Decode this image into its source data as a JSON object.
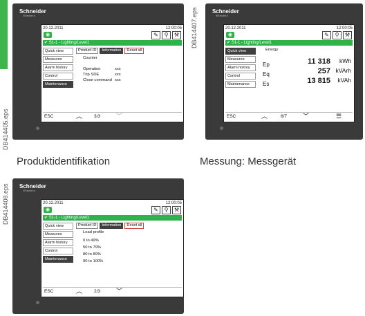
{
  "side_codes": [
    "DB414405.eps",
    "DB414407.eps",
    "DB414408.eps"
  ],
  "brand": {
    "name": "Schneider",
    "sub": "Electric"
  },
  "captions": [
    "Produktidentifikation",
    "Messung: Messgerät"
  ],
  "common": {
    "date": "20.12.2011",
    "time": "12:00:05",
    "breaker": "S1-1 - Lighting/Level1",
    "esc": "ESC",
    "eye_icon": "eye-icon",
    "tool_icons": [
      "edit-icon",
      "search-icon",
      "tools-icon"
    ],
    "menu": [
      "Quick view",
      "Measures",
      "Alarm history",
      "Control",
      "Maintenance"
    ]
  },
  "device1": {
    "active_menu": "Maintenance",
    "tabs": [
      "Product ID",
      "Information",
      "Reset all"
    ],
    "active_tab": "Information",
    "rows": [
      {
        "key": "Counter",
        "val": ""
      },
      {
        "key": "",
        "val": ""
      },
      {
        "key": "Operation",
        "val": "xxx"
      },
      {
        "key": "Trip SDE",
        "val": "xxx"
      },
      {
        "key": "Close command",
        "val": "xxx"
      }
    ],
    "page": "3/3"
  },
  "device2": {
    "active_menu": "Quick view",
    "title": "Energy",
    "rows": [
      {
        "label": "Ep",
        "value": "11 318",
        "unit": "kWh"
      },
      {
        "label": "Eq",
        "value": "257",
        "unit": "kVArh"
      },
      {
        "label": "Es",
        "value": "13 815",
        "unit": "kVAh"
      }
    ],
    "page": "6/7"
  },
  "device3": {
    "active_menu": "Maintenance",
    "tabs": [
      "Product ID",
      "Information",
      "Reset all"
    ],
    "active_tab": "Information",
    "title": "Load profile",
    "rows": [
      "0 to 49%",
      "50 to 79%",
      "80 to 89%",
      "90 to 100%"
    ],
    "page": "2/3"
  }
}
